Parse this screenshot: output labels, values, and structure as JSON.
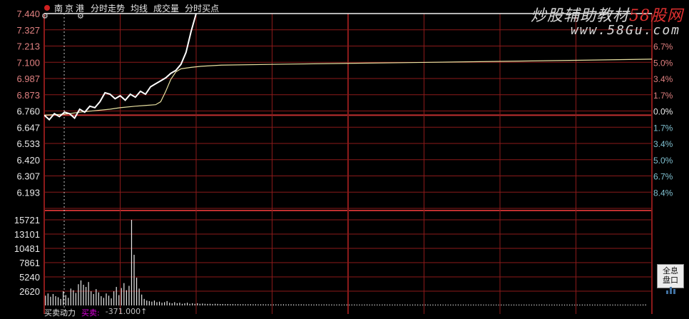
{
  "header": {
    "stock_name": "南京港",
    "items": [
      "分时走势",
      "均线",
      "成交量",
      "分时买点"
    ]
  },
  "watermark": {
    "line1_a": "炒股辅助教材",
    "line1_b": "58股网",
    "line2": "www.58Gu.com"
  },
  "side_button": {
    "line1": "全息",
    "line2": "盘口"
  },
  "bottom_bar": {
    "label": "买卖动力",
    "sub_label": "买卖:",
    "value": "-371.000↑"
  },
  "colors": {
    "grid": "#8b1a1a",
    "zero_line": "#c03030",
    "price_line": "#ffffff",
    "avg_line": "#e8e0a0",
    "price_axis": "#e08080",
    "pct_up": "#e08080",
    "pct_down": "#80c0d0",
    "volume": "#e8e8e8"
  },
  "chart_data": {
    "type": "line",
    "price_ticks": [
      "7.440",
      "7.327",
      "7.213",
      "7.100",
      "6.987",
      "6.873",
      "6.760",
      "6.647",
      "6.533",
      "6.420",
      "6.307",
      "6.193"
    ],
    "pct_ticks": [
      "6.7%",
      "5.0%",
      "3.4%",
      "1.7%",
      "0.0%",
      "1.7%",
      "3.4%",
      "5.0%",
      "6.7%",
      "8.4%"
    ],
    "volume_ticks": [
      "15721",
      "13101",
      "10481",
      "7861",
      "5240",
      "2620"
    ],
    "price_range": [
      6.136,
      7.44
    ],
    "base_price": 6.76,
    "volume_range": [
      0,
      17300
    ],
    "minutes_total": 240,
    "price": {
      "t": [
        0,
        2,
        4,
        6,
        8,
        10,
        12,
        14,
        16,
        18,
        20,
        22,
        24,
        26,
        28,
        30,
        32,
        34,
        36,
        38,
        40,
        42,
        44,
        46,
        48,
        50,
        52,
        54,
        56,
        58,
        60
      ],
      "v": [
        6.76,
        6.73,
        6.77,
        6.75,
        6.78,
        6.77,
        6.74,
        6.8,
        6.78,
        6.82,
        6.81,
        6.85,
        6.91,
        6.9,
        6.87,
        6.89,
        6.86,
        6.9,
        6.88,
        6.92,
        6.9,
        6.95,
        6.97,
        6.99,
        7.01,
        7.04,
        7.06,
        7.1,
        7.18,
        7.32,
        7.44
      ]
    },
    "avg": {
      "t": [
        0,
        6,
        10,
        14,
        20,
        26,
        30,
        36,
        40,
        44,
        46,
        48,
        50,
        52,
        54,
        58,
        62,
        70,
        90,
        120,
        150,
        180,
        210,
        240
      ],
      "v": [
        6.76,
        6.765,
        6.77,
        6.78,
        6.79,
        6.8,
        6.81,
        6.82,
        6.825,
        6.83,
        6.85,
        6.92,
        7.0,
        7.05,
        7.07,
        7.08,
        7.087,
        7.095,
        7.1,
        7.107,
        7.113,
        7.12,
        7.127,
        7.135
      ]
    },
    "volume": [
      1800,
      2200,
      1600,
      2100,
      1700,
      1500,
      1200,
      2600,
      1900,
      1400,
      3100,
      2800,
      2300,
      3900,
      4600,
      3800,
      3400,
      4300,
      2600,
      2100,
      3000,
      2400,
      1700,
      1400,
      2200,
      1800,
      1300,
      2600,
      3400,
      1900,
      3200,
      4100,
      2800,
      3600,
      15721,
      9300,
      5100,
      3100,
      2000,
      1200,
      900,
      800,
      700,
      900,
      600,
      700,
      500,
      600,
      800,
      500,
      400,
      600,
      400,
      500,
      300,
      400,
      500,
      300,
      400,
      300,
      400,
      300,
      350,
      300,
      280,
      300,
      250,
      300,
      280,
      250,
      260,
      240,
      250,
      230,
      240,
      220,
      230,
      210,
      220,
      200,
      210,
      220,
      200,
      210,
      190,
      200,
      210,
      190,
      200,
      180,
      190,
      200,
      180,
      190,
      200,
      180,
      190,
      200,
      180,
      170,
      190,
      200,
      180,
      170,
      190,
      180,
      170,
      190,
      180,
      170,
      180,
      190,
      170,
      180,
      160,
      170,
      180,
      160,
      170,
      180,
      160,
      170,
      180,
      160,
      170,
      160,
      170,
      180,
      160,
      170,
      160,
      170,
      160,
      170,
      180,
      160,
      170,
      160,
      170,
      160,
      170,
      160,
      170,
      160,
      150,
      160,
      170,
      160,
      150,
      160,
      170,
      160,
      150,
      160,
      150,
      160,
      170,
      150,
      160,
      150,
      160,
      150,
      160,
      170,
      150,
      160,
      150,
      160,
      150,
      160,
      150,
      160,
      170,
      150,
      160,
      150,
      160,
      150,
      160,
      150,
      160,
      150,
      160,
      170,
      150,
      160,
      150,
      160,
      150,
      160,
      150,
      160,
      150,
      160,
      150,
      160,
      170,
      150,
      160,
      150,
      160,
      150,
      160,
      150,
      160,
      150,
      160,
      150,
      160,
      150,
      160,
      150,
      160,
      150,
      160,
      170,
      150,
      160,
      150,
      160,
      150,
      160,
      150,
      160,
      150,
      160,
      150,
      160,
      150,
      160,
      150,
      160,
      150,
      160,
      150,
      160,
      170,
      180
    ]
  }
}
